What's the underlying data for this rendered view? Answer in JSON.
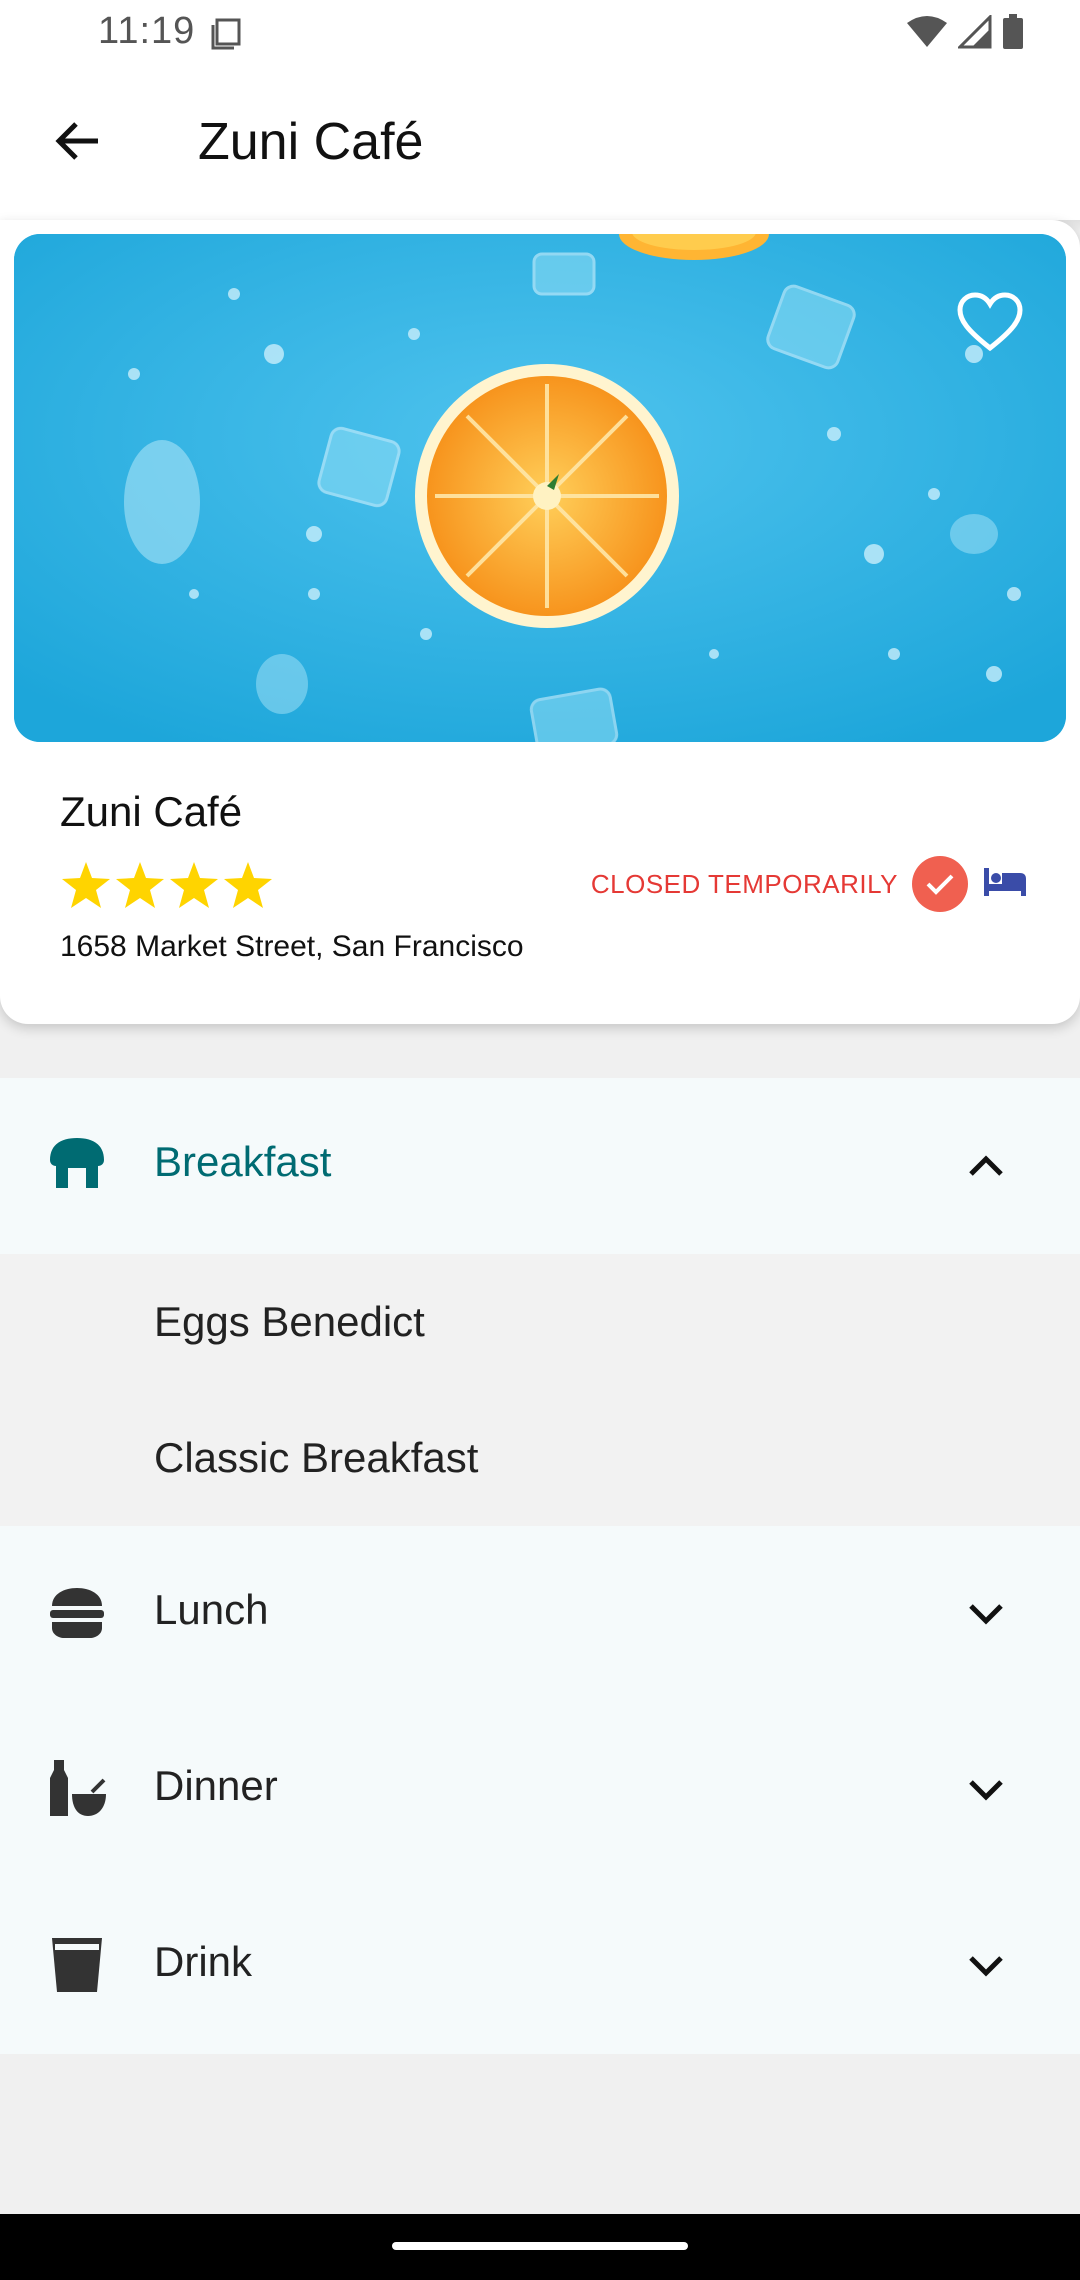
{
  "status_bar": {
    "time": "11:19",
    "icons": [
      "clipboard-icon",
      "wifi-icon",
      "signal-icon",
      "battery-icon"
    ]
  },
  "app_bar": {
    "title": "Zuni Café",
    "back_icon": "arrow-left-icon"
  },
  "restaurant": {
    "name": "Zuni Café",
    "rating": 4,
    "rating_max": 4,
    "status": "CLOSED TEMPORARILY",
    "address": "1658 Market Street, San Francisco",
    "favorite_icon": "heart-outline-icon",
    "verified_icon": "check-circle-icon",
    "hotel_icon": "bed-icon"
  },
  "menu": {
    "categories": [
      {
        "label": "Breakfast",
        "icon": "breakfast-icon",
        "expanded": true,
        "items": [
          "Eggs Benedict",
          "Classic Breakfast"
        ]
      },
      {
        "label": "Lunch",
        "icon": "burger-icon",
        "expanded": false
      },
      {
        "label": "Dinner",
        "icon": "dinner-icon",
        "expanded": false
      },
      {
        "label": "Drink",
        "icon": "glass-icon",
        "expanded": false
      }
    ]
  },
  "colors": {
    "accent": "#006b72",
    "status_red": "#e53935",
    "star": "#ffd400",
    "hero_blue": "#36b4e4",
    "bed": "#3a4ca8"
  }
}
